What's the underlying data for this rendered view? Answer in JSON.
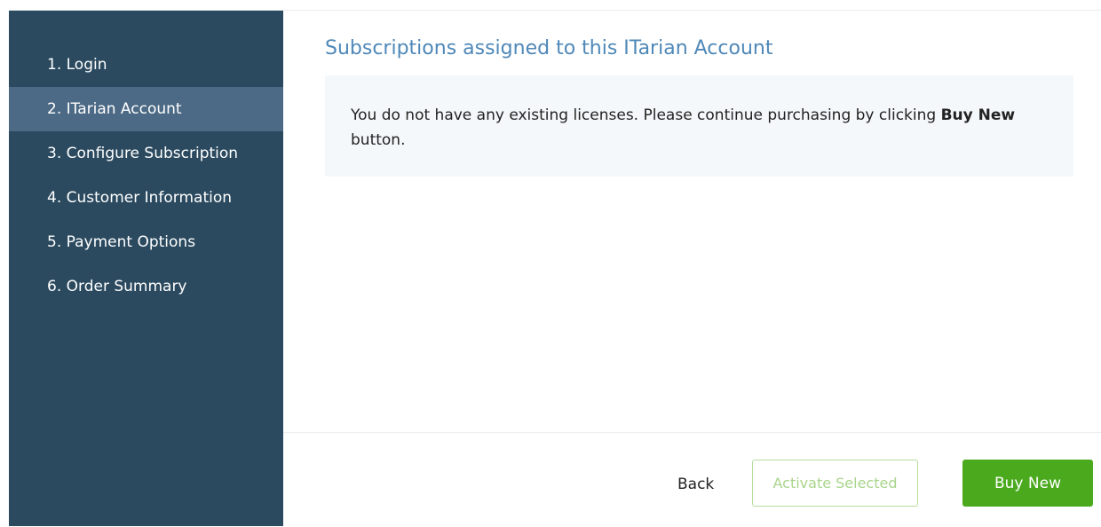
{
  "sidebar": {
    "steps": [
      {
        "label": "1. Login"
      },
      {
        "label": "2. ITarian Account"
      },
      {
        "label": "3. Configure Subscription"
      },
      {
        "label": "4. Customer Information"
      },
      {
        "label": "5. Payment Options"
      },
      {
        "label": "6. Order Summary"
      }
    ],
    "active_index": 1
  },
  "main": {
    "title": "Subscriptions assigned to this ITarian Account",
    "notice": {
      "text_before": "You do not have any existing licenses. Please continue purchasing by clicking ",
      "bold": "Buy New",
      "text_after": " button."
    }
  },
  "footer": {
    "back_label": "Back",
    "activate_label": "Activate Selected",
    "buy_label": "Buy New"
  },
  "colors": {
    "sidebar_bg": "#2b4a5f",
    "sidebar_active_bg": "#4c6a85",
    "title_color": "#4f88b8",
    "primary_green": "#4ba91e",
    "disabled_green": "#a8d58c"
  }
}
